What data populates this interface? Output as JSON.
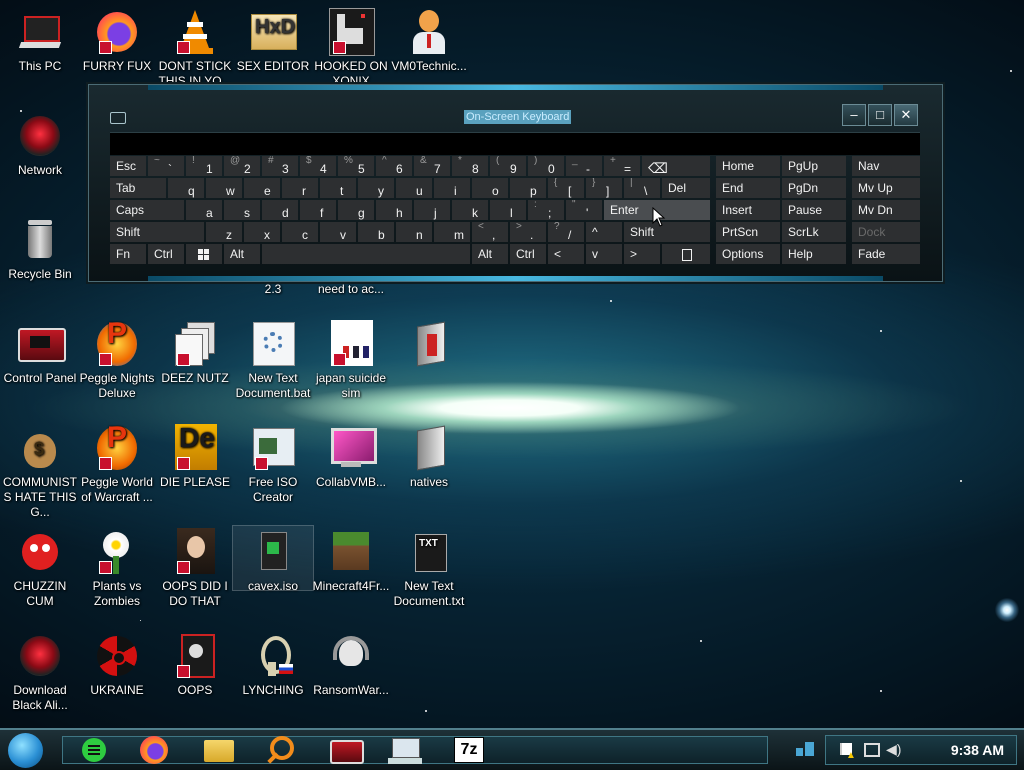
{
  "desktop": {
    "icons": [
      {
        "label": "This PC"
      },
      {
        "label": "FURRY FUX"
      },
      {
        "label": "DONT STICK THIS IN YO..."
      },
      {
        "label": "SEX EDITOR"
      },
      {
        "label": "HOOKED ON XONIX"
      },
      {
        "label": "VM0Technic..."
      },
      {
        "label": "Network"
      },
      {
        "label": "Recycle Bin"
      },
      {
        "label": "2.3"
      },
      {
        "label": "need to ac..."
      },
      {
        "label": "Control Panel"
      },
      {
        "label": "Peggle Nights Deluxe"
      },
      {
        "label": "DEEZ NUTZ"
      },
      {
        "label": "New Text Document.bat"
      },
      {
        "label": "japan suicide sim"
      },
      {
        "label": ""
      },
      {
        "label": "COMMUNISTS HATE THIS G..."
      },
      {
        "label": "Peggle World of Warcraft ..."
      },
      {
        "label": "DIE PLEASE"
      },
      {
        "label": "Free ISO Creator"
      },
      {
        "label": "CollabVMB..."
      },
      {
        "label": "natives"
      },
      {
        "label": "CHUZZIN CUM"
      },
      {
        "label": "Plants vs Zombies"
      },
      {
        "label": "OOPS DID I DO THAT"
      },
      {
        "label": "cavex.iso"
      },
      {
        "label": "Minecraft4Fr..."
      },
      {
        "label": "New Text Document.txt"
      },
      {
        "label": "Download Black Ali..."
      },
      {
        "label": "UKRAINE"
      },
      {
        "label": "OOPS"
      },
      {
        "label": "LYNCHING"
      },
      {
        "label": "RansomWar..."
      }
    ]
  },
  "osk": {
    "title": "On-Screen Keyboard",
    "keys": {
      "esc": "Esc",
      "backtick": "`",
      "tilde": "~",
      "n1": "1",
      "s1": "!",
      "n2": "2",
      "s2": "@",
      "n3": "3",
      "s3": "#",
      "n4": "4",
      "s4": "$",
      "n5": "5",
      "s5": "%",
      "n6": "6",
      "s6": "^",
      "n7": "7",
      "s7": "&",
      "n8": "8",
      "s8": "*",
      "n9": "9",
      "s9": "(",
      "n0": "0",
      "s0": ")",
      "minus": "-",
      "underscore": "_",
      "equals": "=",
      "plus": "+",
      "tab": "Tab",
      "q": "q",
      "w": "w",
      "e": "e",
      "r": "r",
      "t": "t",
      "y": "y",
      "u": "u",
      "i": "i",
      "o": "o",
      "p": "p",
      "lbracket": "[",
      "lbrace": "{",
      "rbracket": "]",
      "rbrace": "}",
      "backslash": "\\",
      "pipe": "|",
      "del": "Del",
      "caps": "Caps",
      "a": "a",
      "s": "s",
      "d": "d",
      "f": "f",
      "g": "g",
      "h": "h",
      "j": "j",
      "k": "k",
      "l": "l",
      "semicolon": ";",
      "colon": ":",
      "quote": "'",
      "dquote": "\"",
      "enter": "Enter",
      "shift": "Shift",
      "z": "z",
      "x": "x",
      "c": "c",
      "v": "v",
      "b": "b",
      "n": "n",
      "m": "m",
      "comma": ",",
      "lt": "<",
      "period": ".",
      "gt": ">",
      "slash": "/",
      "question": "?",
      "up": "^",
      "rshift": "Shift",
      "fn": "Fn",
      "ctrl": "Ctrl",
      "alt": "Alt",
      "ralt": "Alt",
      "rctrl": "Ctrl",
      "left": "<",
      "down": "v",
      "right": ">",
      "home": "Home",
      "pgup": "PgUp",
      "nav": "Nav",
      "end": "End",
      "pgdn": "PgDn",
      "mvup": "Mv Up",
      "insert": "Insert",
      "pause": "Pause",
      "mvdn": "Mv Dn",
      "prtscn": "PrtScn",
      "scrlk": "ScrLk",
      "dock": "Dock",
      "options": "Options",
      "help": "Help",
      "fade": "Fade"
    }
  },
  "taskbar": {
    "clock": "9:38 AM",
    "apps": [
      "notes",
      "firefox",
      "file-explorer",
      "search",
      "vm",
      "remote-desktop",
      "7zip"
    ]
  },
  "colors": {
    "accent": "#48b8e0",
    "key_bg": "#2d2f31",
    "key_hover": "#4a4d50"
  }
}
